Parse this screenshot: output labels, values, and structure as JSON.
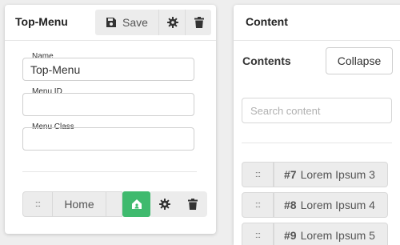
{
  "left_panel": {
    "title": "Top-Menu",
    "save_label": "Save",
    "fields": [
      {
        "label": "Name",
        "value": "Top-Menu"
      },
      {
        "label": "Menu ID",
        "value": ""
      },
      {
        "label": "Menu Class",
        "value": ""
      }
    ],
    "menu_item": {
      "drag_glyph": ":::",
      "label": "Home"
    }
  },
  "right_panel": {
    "title": "Content",
    "contents_label": "Contents",
    "collapse_label": "Collapse",
    "search_placeholder": "Search content",
    "items": [
      {
        "drag_glyph": ":::",
        "number": "#7",
        "label": "Lorem Ipsum 3"
      },
      {
        "drag_glyph": ":::",
        "number": "#8",
        "label": "Lorem Ipsum 4"
      },
      {
        "drag_glyph": ":::",
        "number": "#9",
        "label": "Lorem Ipsum 5"
      }
    ]
  },
  "icons": {
    "save": "floppy-disk-icon",
    "settings": "gear-icon",
    "delete": "trash-icon",
    "home": "home-icon"
  },
  "colors": {
    "accent_green": "#3fba6e",
    "button_gray": "#ececec",
    "background": "#eeeeee"
  }
}
